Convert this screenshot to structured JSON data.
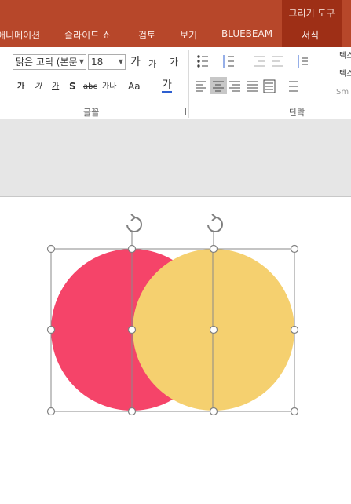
{
  "tabs": {
    "context_group": "그리기 도구",
    "items": [
      {
        "label": "애니메이션"
      },
      {
        "label": "슬라이드 쇼"
      },
      {
        "label": "검토"
      },
      {
        "label": "보기"
      },
      {
        "label": "BLUEBEAM"
      },
      {
        "label": "서식"
      }
    ]
  },
  "ribbon": {
    "font_name": "맑은 고딕 (본문",
    "font_size": "18",
    "grow_font": "가",
    "shrink_font": "가",
    "clear_format": "가",
    "bold": "가",
    "italic": "가",
    "underline": "가",
    "shadow": "S",
    "strike": "abc",
    "char_spacing": "가나",
    "change_case": "Aa",
    "font_color": "가",
    "font_group": "글꼴",
    "paragraph_group": "단락",
    "text_dir_partial": "텍스",
    "align_text_partial": "텍스",
    "smartart_partial": "Sm"
  },
  "colors": {
    "title_bar": "#b7472a",
    "context_tab": "#9e2f16",
    "circle_left": "#f54469",
    "circle_right": "#f5d06f",
    "handle_stroke": "#808080"
  },
  "shapes": [
    {
      "name": "left-circle",
      "fill": "#f54469"
    },
    {
      "name": "right-circle",
      "fill": "#f5d06f"
    }
  ]
}
